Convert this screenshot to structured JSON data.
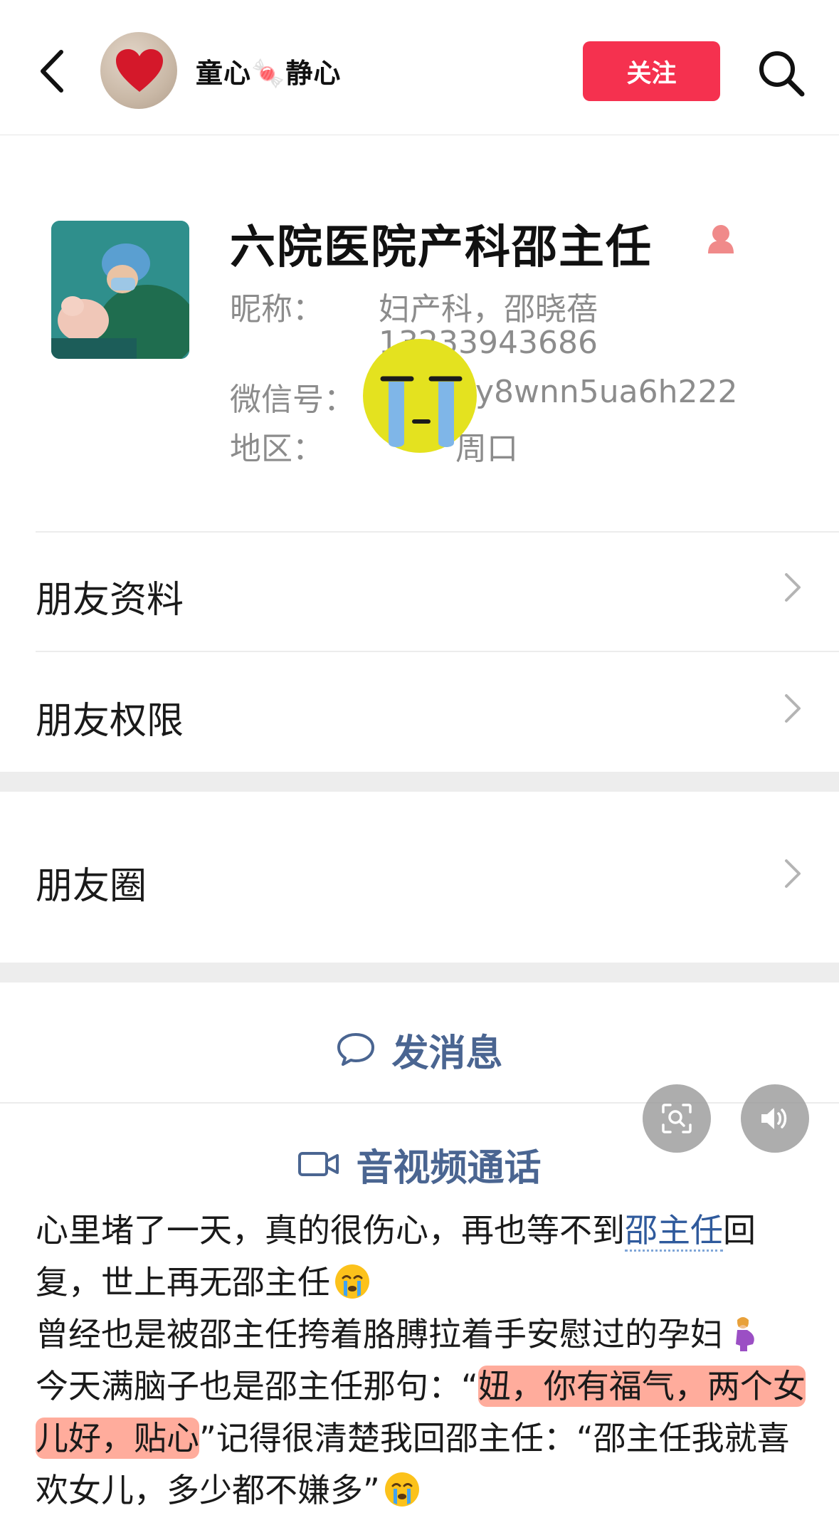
{
  "topbar": {
    "author_name": "童心🍬静心",
    "follow_label": "关注"
  },
  "profile": {
    "name": "六院医院产科邵主任",
    "nickname_label": "昵称：",
    "nickname_value": "妇产科，邵晓蓓",
    "nickname_value_line2": "13233943686",
    "wechat_label": "微信号：",
    "wechat_value": "y8wnn5ua6h222",
    "region_label": "地区：",
    "region_value": "周口"
  },
  "rows": {
    "friend_info": "朋友资料",
    "friend_permissions": "朋友权限",
    "moments": "朋友圈"
  },
  "actions": {
    "send_message": "发消息",
    "av_call": "音视频通话"
  },
  "caption": {
    "p1_a": "心里堵了一天，真的很伤心，再也等不到",
    "p1_mention": "邵主任",
    "p1_b": "回复，世上再无邵主任",
    "p2": "曾经也是被邵主任挎着胳膊拉着手安慰过的孕妇",
    "p3_a": "今天满脑子也是邵主任那句：“",
    "p3_hl": "妞，你有福气，两个女儿好，贴心",
    "p3_b": "”记得很清楚我回邵主任：“邵主任我就喜欢女儿，多少都不嫌多”"
  },
  "colors": {
    "accent": "#f5314f",
    "link": "#4a6591",
    "highlight": "#ff684a"
  },
  "icons": [
    "back-icon",
    "search-icon",
    "female-icon",
    "chevron-right-icon",
    "chat-bubble-icon",
    "video-camera-icon",
    "scan-search-icon",
    "speaker-icon",
    "crying-face-icon",
    "pregnant-woman-icon"
  ]
}
